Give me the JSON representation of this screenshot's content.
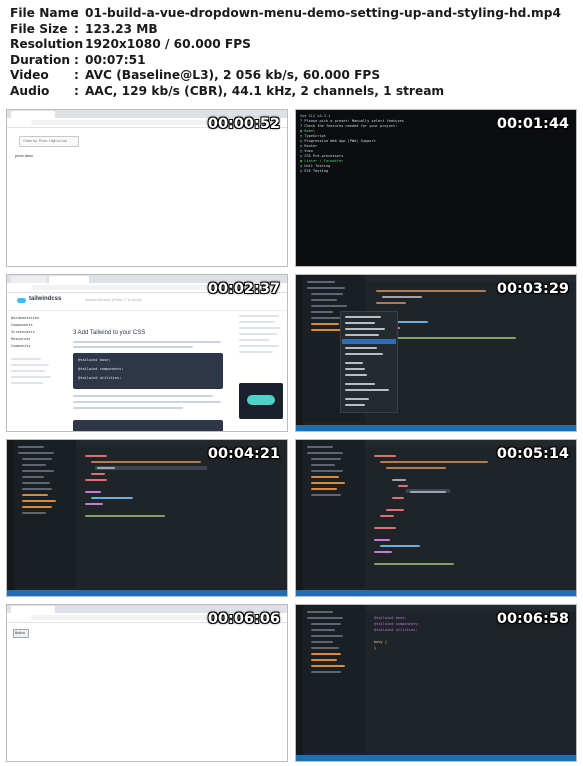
{
  "file_info": {
    "rows": [
      {
        "key": "File Name",
        "value": "01-build-a-vue-dropdown-menu-demo-setting-up-and-styling-hd.mp4"
      },
      {
        "key": "File Size",
        "value": "123.23 MB"
      },
      {
        "key": "Resolution",
        "value": "1920x1080 / 60.000 FPS"
      },
      {
        "key": "Duration",
        "value": "00:07:51"
      },
      {
        "key": "Video",
        "value": "AVC (Baseline@L3), 2 056 kb/s, 60.000 FPS"
      },
      {
        "key": "Audio",
        "value": "AAC, 129 kb/s (CBR), 44.1 kHz, 2 channels, 1 stream"
      }
    ],
    "separator": ":"
  },
  "thumbnails": [
    {
      "timestamp": "00:00:52",
      "kind": "browser-demo"
    },
    {
      "timestamp": "00:01:44",
      "kind": "terminal"
    },
    {
      "timestamp": "00:02:37",
      "kind": "browser-docs"
    },
    {
      "timestamp": "00:03:29",
      "kind": "editor-context-menu"
    },
    {
      "timestamp": "00:04:21",
      "kind": "editor"
    },
    {
      "timestamp": "00:05:14",
      "kind": "editor"
    },
    {
      "timestamp": "00:06:06",
      "kind": "browser-blank"
    },
    {
      "timestamp": "00:06:58",
      "kind": "editor-css"
    }
  ],
  "thumb_text": {
    "t1_placeholder": "Order by: Price: High to low",
    "t1_item": "price desc",
    "t2_lines": [
      "Vue CLI v4.3.1",
      "? Please pick a preset: Manually select features",
      "? Check the features needed for your project:",
      " ◉ Babel",
      " ◯ TypeScript",
      " ◯ Progressive Web App (PWA) Support",
      " ◯ Router",
      " ◯ Vuex",
      " ◯ CSS Pre-processors",
      " ◉ Linter / Formatter",
      " ◯ Unit Testing",
      " ◯ E2E Testing"
    ],
    "t3_logo": "tailwindcss",
    "t3_heading": "3   Add Tailwind to your CSS",
    "t3_code": [
      "@tailwind base;",
      "@tailwind components;",
      "@tailwind utilities;"
    ],
    "t3_search": "Search the docs (Press \"/\" to focus)",
    "t3_sidebar": [
      "Documentation",
      "Components",
      "Screencasts",
      "Resources",
      "Community"
    ],
    "t7_button": "Button",
    "t8_code": [
      "@tailwind base;",
      "@tailwind components;",
      "@tailwind utilities;",
      "body {",
      "}"
    ]
  }
}
